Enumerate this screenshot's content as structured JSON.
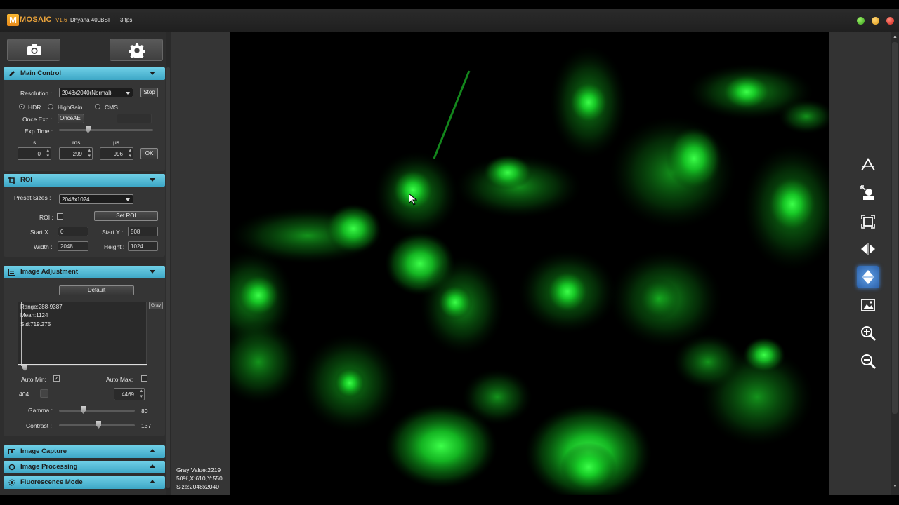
{
  "titlebar": {
    "logo_letter": "M",
    "app_name": "MOSAIC",
    "version": "V1.6",
    "camera": "Dhyana 400BSI",
    "fps": "3 fps"
  },
  "toolbar": {
    "camera_icon": "camera-icon",
    "settings_icon": "gear-icon"
  },
  "main_control": {
    "title": "Main Control",
    "resolution_label": "Resolution :",
    "resolution_value": "2048x2040(Normal)",
    "stop_label": "Stop",
    "modes": [
      "HDR",
      "HighGain",
      "CMS"
    ],
    "selected_mode": "HDR",
    "once_exp_label": "Once Exp :",
    "once_exp_value": "OnceAE",
    "exp_time_label": "Exp Time :",
    "unit_s": "s",
    "unit_ms": "ms",
    "unit_us": "μs",
    "val_s": "0",
    "val_ms": "299",
    "val_us": "996",
    "ok_label": "OK"
  },
  "roi": {
    "title": "ROI",
    "preset_label": "Preset Sizes :",
    "preset_value": "2048x1024",
    "roi_label": "ROI :",
    "set_roi_label": "Set ROI",
    "start_x_label": "Start X :",
    "start_x": "0",
    "start_y_label": "Start Y :",
    "start_y": "508",
    "width_label": "Width :",
    "width": "2048",
    "height_label": "Height :",
    "height": "1024"
  },
  "image_adjustment": {
    "title": "Image Adjustment",
    "default_label": "Default",
    "range": "Range:288-9387",
    "mean": "Mean:1124",
    "std": "Std:719.275",
    "gray_label": "Gray",
    "auto_min_label": "Auto Min:",
    "auto_min_checked": true,
    "auto_max_label": "Auto Max:",
    "auto_max_checked": false,
    "min_value": "404",
    "max_value": "4469",
    "gamma_label": "Gamma :",
    "gamma_value": "80",
    "contrast_label": "Contrast :",
    "contrast_value": "137"
  },
  "collapsed_sections": [
    "Image Capture",
    "Image Processing",
    "Fluorescence Mode"
  ],
  "status": {
    "gray_value": "Gray Value:2219",
    "position": "50%,X:610,Y:550",
    "size": "Size:2048x2040"
  },
  "right_tools": [
    "auto-exposure-icon",
    "zoom-region-icon",
    "fit-window-icon",
    "flip-horizontal-icon",
    "flip-vertical-icon",
    "image-icon",
    "zoom-in-icon",
    "zoom-out-icon"
  ],
  "colors": {
    "accent": "#3da7c6",
    "brand": "#e9a23a",
    "fluorescence": "#1aff3a"
  }
}
